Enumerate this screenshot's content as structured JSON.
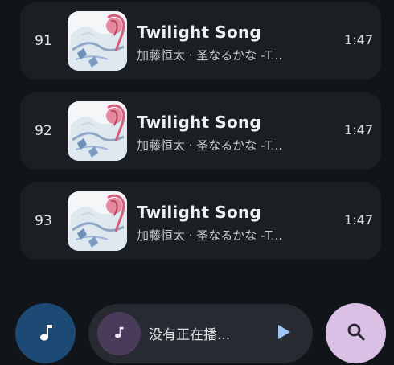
{
  "tracks": [
    {
      "number": "91",
      "title": "Twilight Song",
      "artist": "加藤恒太 · 圣なるかな -T...",
      "duration": "1:47"
    },
    {
      "number": "92",
      "title": "Twilight Song",
      "artist": "加藤恒太 · 圣なるかな -T...",
      "duration": "1:47"
    },
    {
      "number": "93",
      "title": "Twilight Song",
      "artist": "加藤恒太 · 圣なるかな -T...",
      "duration": "1:47"
    }
  ],
  "player": {
    "status_text": "没有正在播..."
  },
  "icons": {
    "left_fab": "music-note-icon",
    "player_art": "music-note-icon",
    "play": "play-icon",
    "right_fab": "search-icon"
  },
  "colors": {
    "background": "#111418",
    "card": "#1b1f24",
    "left_fab": "#1c4a74",
    "player_bar": "#272b31",
    "player_art": "#4a3b5a",
    "right_fab": "#dbc0e6"
  }
}
